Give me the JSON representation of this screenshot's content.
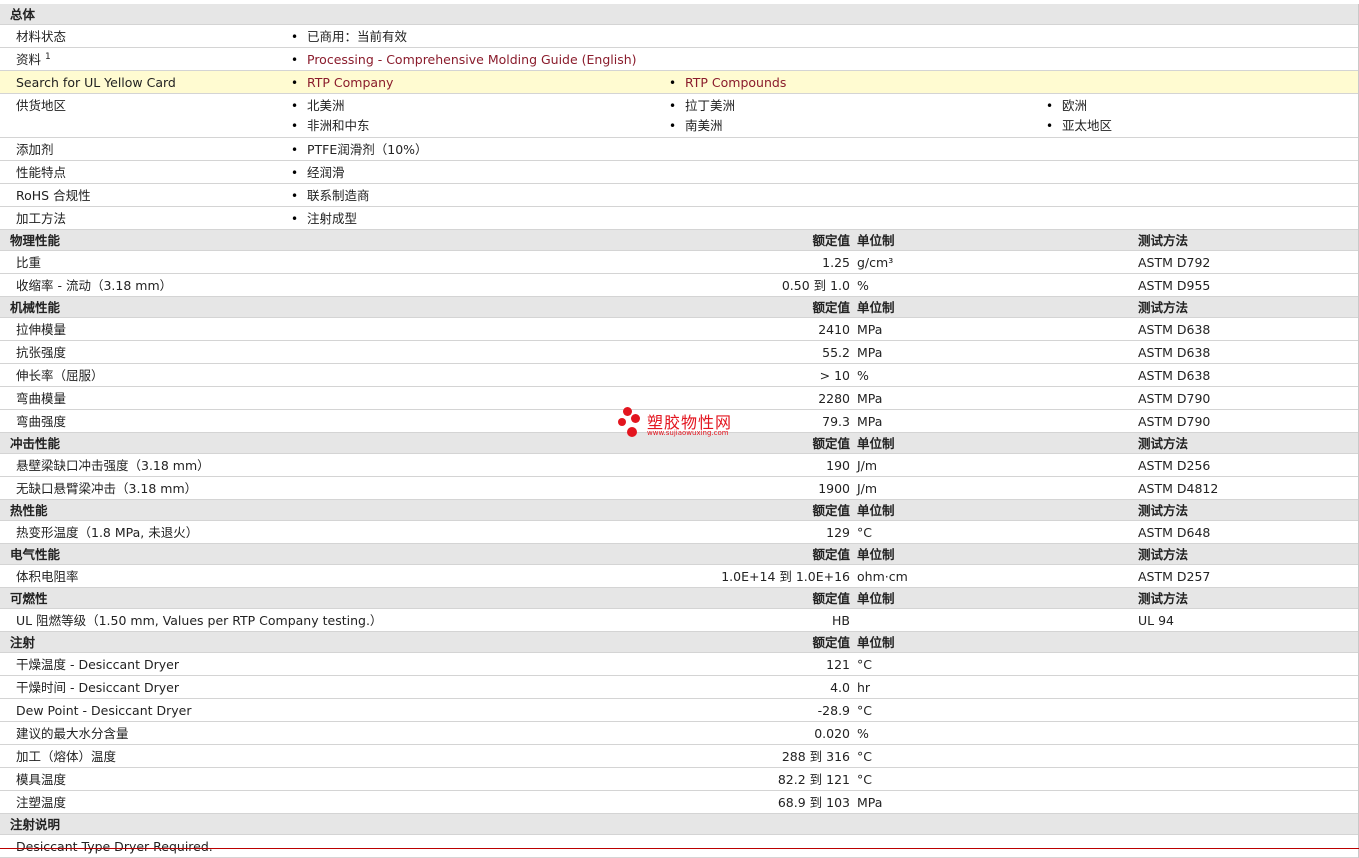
{
  "general": {
    "title": "总体",
    "rows": [
      {
        "label": "材料状态",
        "items": [
          "已商用：当前有效"
        ]
      },
      {
        "label": "资料",
        "sup": "1",
        "links": [
          "Processing - Comprehensive Molding Guide (English)"
        ]
      },
      {
        "label": "Search for UL Yellow Card",
        "links": [
          "RTP Company",
          "RTP Compounds"
        ]
      },
      {
        "label": "供货地区",
        "items": [
          "北美洲",
          "拉丁美洲",
          "欧洲",
          "非洲和中东",
          "南美洲",
          "亚太地区"
        ]
      },
      {
        "label": "添加剂",
        "items": [
          "PTFE润滑剂（10%）"
        ]
      },
      {
        "label": "性能特点",
        "items": [
          "经润滑"
        ]
      },
      {
        "label": "RoHS 合规性",
        "items": [
          "联系制造商"
        ]
      },
      {
        "label": "加工方法",
        "items": [
          "注射成型"
        ]
      }
    ]
  },
  "headers": {
    "value": "额定值",
    "unit": "单位制",
    "method": "测试方法"
  },
  "physical": {
    "title": "物理性能",
    "rows": [
      {
        "label": "比重",
        "value": "1.25",
        "unit": "g/cm³",
        "method": "ASTM D792"
      },
      {
        "label": "收缩率 - 流动（3.18 mm）",
        "value": "0.50 到 1.0",
        "unit": "%",
        "method": "ASTM D955"
      }
    ]
  },
  "mechanical": {
    "title": "机械性能",
    "rows": [
      {
        "label": "拉伸模量",
        "value": "2410",
        "unit": "MPa",
        "method": "ASTM D638"
      },
      {
        "label": "抗张强度",
        "value": "55.2",
        "unit": "MPa",
        "method": "ASTM D638"
      },
      {
        "label": "伸长率（屈服）",
        "value": "> 10",
        "unit": "%",
        "method": "ASTM D638"
      },
      {
        "label": "弯曲模量",
        "value": "2280",
        "unit": "MPa",
        "method": "ASTM D790"
      },
      {
        "label": "弯曲强度",
        "value": "79.3",
        "unit": "MPa",
        "method": "ASTM D790"
      }
    ]
  },
  "impact": {
    "title": "冲击性能",
    "rows": [
      {
        "label": "悬壁梁缺口冲击强度（3.18 mm）",
        "value": "190",
        "unit": "J/m",
        "method": "ASTM D256"
      },
      {
        "label": "无缺口悬臂梁冲击（3.18 mm）",
        "value": "1900",
        "unit": "J/m",
        "method": "ASTM D4812"
      }
    ]
  },
  "thermal": {
    "title": "热性能",
    "rows": [
      {
        "label": "热变形温度（1.8 MPa, 未退火）",
        "value": "129",
        "unit": "°C",
        "method": "ASTM D648"
      }
    ]
  },
  "electrical": {
    "title": "电气性能",
    "rows": [
      {
        "label": "体积电阻率",
        "value": "1.0E+14 到 1.0E+16",
        "unit": "ohm·cm",
        "method": "ASTM D257"
      }
    ]
  },
  "flammability": {
    "title": "可燃性",
    "rows": [
      {
        "label": "UL 阻燃等级（1.50 mm, Values per RTP Company testing.）",
        "value": "HB",
        "unit": "",
        "method": "UL 94"
      }
    ]
  },
  "injection": {
    "title": "注射",
    "rows": [
      {
        "label": "干燥温度 - Desiccant Dryer",
        "value": "121",
        "unit": "°C"
      },
      {
        "label": "干燥时间 - Desiccant Dryer",
        "value": "4.0",
        "unit": "hr"
      },
      {
        "label": "Dew Point - Desiccant Dryer",
        "value": "-28.9",
        "unit": "°C"
      },
      {
        "label": "建议的最大水分含量",
        "value": "0.020",
        "unit": "%"
      },
      {
        "label": "加工（熔体）温度",
        "value": "288 到 316",
        "unit": "°C"
      },
      {
        "label": "模具温度",
        "value": "82.2 到 121",
        "unit": "°C"
      },
      {
        "label": "注塑温度",
        "value": "68.9 到 103",
        "unit": "MPa"
      }
    ]
  },
  "injection_notes": {
    "title": "注射说明",
    "text": "Desiccant Type Dryer Required."
  },
  "watermark": {
    "name": "塑胶物性网",
    "url": "www.sujiaowuxing.com"
  },
  "colors": {
    "link": "#8a1c2c",
    "header_bg": "#e6e6e6",
    "highlight_bg": "#fffbd1",
    "watermark": "#e3151f"
  }
}
